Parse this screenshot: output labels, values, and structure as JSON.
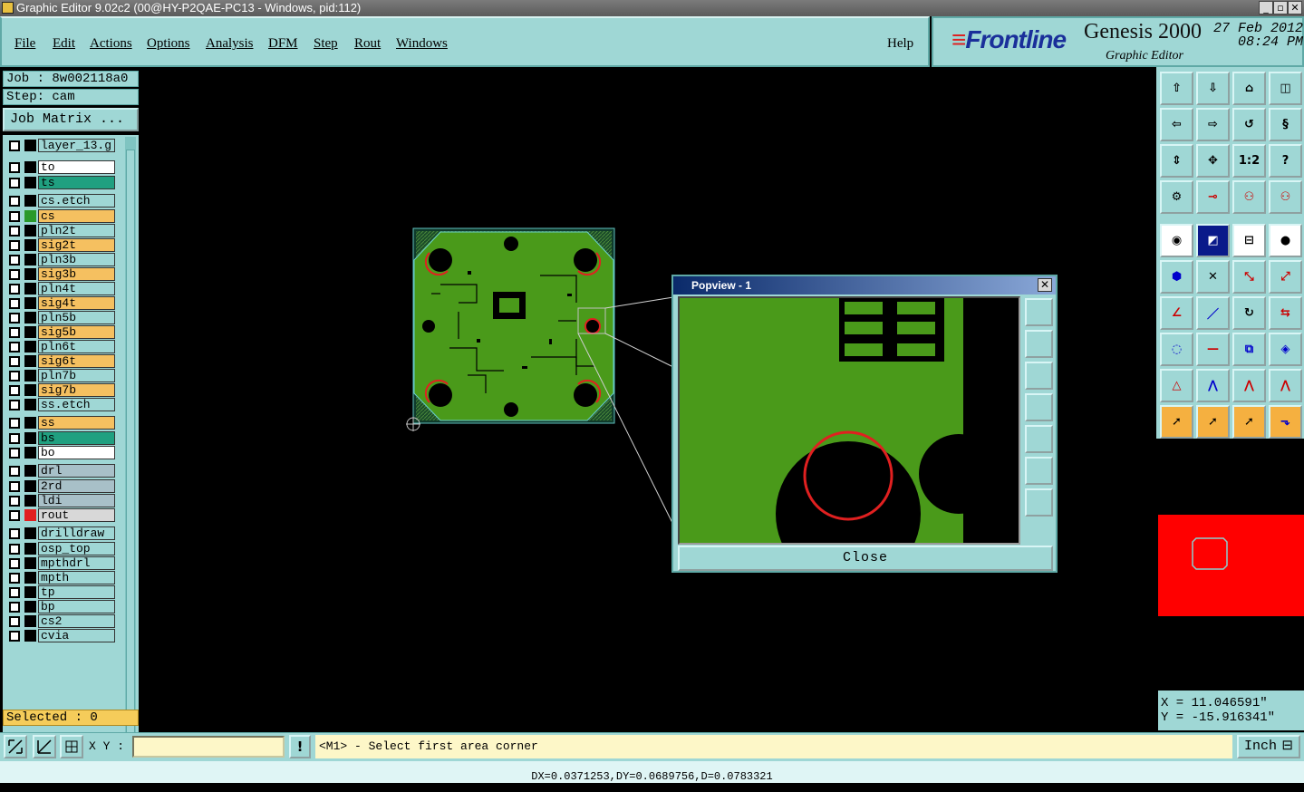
{
  "window": {
    "title": "Graphic Editor 9.02c2 (00@HY-P2QAE-PC13 - Windows, pid:112)"
  },
  "menu": [
    "File",
    "Edit",
    "Actions",
    "Options",
    "Analysis",
    "DFM",
    "Step",
    "Rout",
    "Windows"
  ],
  "help": "Help",
  "brand": {
    "logo": "Frontline",
    "product": "Genesis 2000",
    "subtitle": "Graphic Editor",
    "date": "27 Feb 2012",
    "time": "08:24 PM"
  },
  "job": {
    "job_label": "Job : 8w002118a0",
    "step_label": "Step: cam",
    "matrix_button": "Job Matrix ..."
  },
  "layers": [
    {
      "name": "layer_13.g",
      "color": "#9fd7d5",
      "swatch": "#000000",
      "sep": false
    },
    {
      "name": "to",
      "color": "#ffffff",
      "swatch": "#000000",
      "sep": true
    },
    {
      "name": "ts",
      "color": "#20a080",
      "swatch": "#000000",
      "sep": false
    },
    {
      "name": "cs.etch",
      "color": "#9fd7d5",
      "swatch": "#000000",
      "sep": true
    },
    {
      "name": "cs",
      "color": "#f5c060",
      "swatch": "#2a9a2a",
      "sep": false
    },
    {
      "name": "pln2t",
      "color": "#9fd7d5",
      "swatch": "#000000",
      "sep": false
    },
    {
      "name": "sig2t",
      "color": "#f5c060",
      "swatch": "#000000",
      "sep": false
    },
    {
      "name": "pln3b",
      "color": "#9fd7d5",
      "swatch": "#000000",
      "sep": false
    },
    {
      "name": "sig3b",
      "color": "#f5c060",
      "swatch": "#000000",
      "sep": false
    },
    {
      "name": "pln4t",
      "color": "#9fd7d5",
      "swatch": "#000000",
      "sep": false
    },
    {
      "name": "sig4t",
      "color": "#f5c060",
      "swatch": "#000000",
      "sep": false
    },
    {
      "name": "pln5b",
      "color": "#9fd7d5",
      "swatch": "#000000",
      "sep": false
    },
    {
      "name": "sig5b",
      "color": "#f5c060",
      "swatch": "#000000",
      "sep": false
    },
    {
      "name": "pln6t",
      "color": "#9fd7d5",
      "swatch": "#000000",
      "sep": false
    },
    {
      "name": "sig6t",
      "color": "#f5c060",
      "swatch": "#000000",
      "sep": false
    },
    {
      "name": "pln7b",
      "color": "#9fd7d5",
      "swatch": "#000000",
      "sep": false
    },
    {
      "name": "sig7b",
      "color": "#f5c060",
      "swatch": "#000000",
      "sep": false
    },
    {
      "name": "ss.etch",
      "color": "#9fd7d5",
      "swatch": "#000000",
      "sep": false
    },
    {
      "name": "ss",
      "color": "#f5c060",
      "swatch": "#000000",
      "sep": true
    },
    {
      "name": "bs",
      "color": "#20a080",
      "swatch": "#000000",
      "sep": false
    },
    {
      "name": "bo",
      "color": "#ffffff",
      "swatch": "#000000",
      "sep": false
    },
    {
      "name": "drl",
      "color": "#a8c0c8",
      "swatch": "#000000",
      "sep": true
    },
    {
      "name": "2rd",
      "color": "#a8c0c8",
      "swatch": "#000000",
      "sep": false
    },
    {
      "name": "ldi",
      "color": "#a8c0c8",
      "swatch": "#000000",
      "sep": false
    },
    {
      "name": "rout",
      "color": "#d8d8d8",
      "swatch": "#e02020",
      "sep": false
    },
    {
      "name": "drilldraw",
      "color": "#9fd7d5",
      "swatch": "#000000",
      "sep": true
    },
    {
      "name": "osp_top",
      "color": "#9fd7d5",
      "swatch": "#000000",
      "sep": false
    },
    {
      "name": "mpthdrl",
      "color": "#9fd7d5",
      "swatch": "#000000",
      "sep": false
    },
    {
      "name": "mpth",
      "color": "#9fd7d5",
      "swatch": "#000000",
      "sep": false
    },
    {
      "name": "tp",
      "color": "#9fd7d5",
      "swatch": "#000000",
      "sep": false
    },
    {
      "name": "bp",
      "color": "#9fd7d5",
      "swatch": "#000000",
      "sep": false
    },
    {
      "name": "cs2",
      "color": "#9fd7d5",
      "swatch": "#000000",
      "sep": false
    },
    {
      "name": "cvia",
      "color": "#9fd7d5",
      "swatch": "#000000",
      "sep": false
    }
  ],
  "selected": "Selected : 0",
  "popview": {
    "title": "Popview - 1",
    "close": "Close"
  },
  "coords": {
    "x": "X = 11.046591\"",
    "y": "Y = -15.916341\""
  },
  "bottom": {
    "xy_label": "X Y :",
    "xy_value": "",
    "prompt": "<M1> - Select first area corner",
    "unit": "Inch"
  },
  "status": "DX=0.0371253,DY=0.0689756,D=0.0783321",
  "colors": {
    "panel": "#9fd7d5",
    "board": "#4a9a1a",
    "highlight": "#e02020"
  }
}
